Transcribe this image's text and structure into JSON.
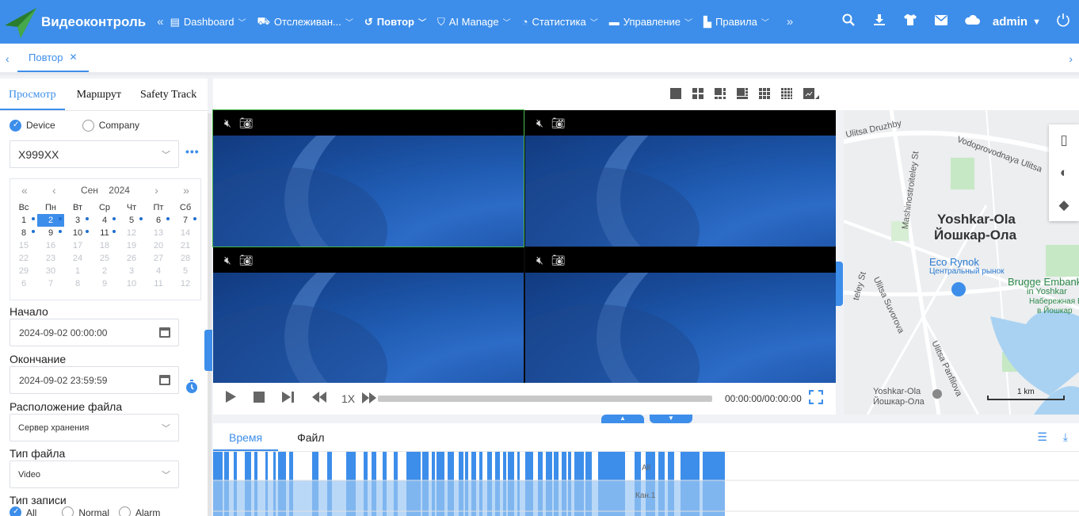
{
  "header": {
    "brand": "Видеоконтроль",
    "nav": [
      {
        "label": "Dashboard",
        "icon": "dashboard-icon"
      },
      {
        "label": "Отслеживан...",
        "icon": "car-icon"
      },
      {
        "label": "Повтор",
        "icon": "replay-icon",
        "active": true
      },
      {
        "label": "AI Manage",
        "icon": "shield-icon"
      },
      {
        "label": "Статистика",
        "icon": "pie-chart-icon"
      },
      {
        "label": "Управление",
        "icon": "bus-icon"
      },
      {
        "label": "Правила",
        "icon": "rule-icon"
      }
    ],
    "user": "admin"
  },
  "tabs": {
    "active": "Повтор"
  },
  "left": {
    "tabs": [
      "Просмотр",
      "Маршрут",
      "Safety Track"
    ],
    "source": {
      "device": "Device",
      "company": "Company"
    },
    "device_value": "X999XX",
    "calendar": {
      "month": "Сен",
      "year": "2024",
      "weekdays": [
        "Вс",
        "Пн",
        "Вт",
        "Ср",
        "Чт",
        "Пт",
        "Сб"
      ],
      "days": [
        "1",
        "2",
        "3",
        "4",
        "5",
        "6",
        "7",
        "8",
        "9",
        "10",
        "11",
        "12",
        "13",
        "14",
        "15",
        "16",
        "17",
        "18",
        "19",
        "20",
        "21",
        "22",
        "23",
        "24",
        "25",
        "26",
        "27",
        "28",
        "29",
        "30",
        "1",
        "2",
        "3",
        "4",
        "5",
        "6",
        "7",
        "8",
        "9",
        "10",
        "11",
        "12"
      ],
      "selected": "2",
      "with_records": [
        "1",
        "2",
        "3",
        "4",
        "5",
        "6",
        "7",
        "8",
        "9",
        "10",
        "11"
      ]
    },
    "start_label": "Начало",
    "start_value": "2024-09-02 00:00:00",
    "end_label": "Окончание",
    "end_value": "2024-09-02 23:59:59",
    "location_label": "Расположение файла",
    "location_value": "Сервер хранения",
    "filetype_label": "Тип файла",
    "filetype_value": "Video",
    "record_label": "Тип записи",
    "record_options": [
      "All",
      "Normal",
      "Alarm"
    ]
  },
  "player": {
    "speed": "1X",
    "time": "00:00:00/00:00:00"
  },
  "map": {
    "labels": {
      "street1": "Ulitsa Druzhby",
      "street2": "Vodoprovodnaya Ulitsa",
      "street3": "Mashinostroiteley St",
      "city_en": "Yoshkar-Ola",
      "city_ru": "Йошкар-Ола",
      "market_en": "Eco Rynok",
      "market_ru": "Центральный рынок",
      "emb_en": "Brugge Embankm",
      "emb_en2": "in Yoshkar",
      "emb_ru": "Набережная Бр",
      "emb_ru2": "в Йошкар",
      "street4": "Ulitsa Suvorova",
      "street5": "Ulitsa Panfilova",
      "street6": "teley St",
      "st_en": "Yoshkar-Ola",
      "st_ru": "Йошкар-Ола",
      "scale": "1 km"
    }
  },
  "bottom": {
    "tabs": [
      "Время",
      "Файл"
    ],
    "row1": "All",
    "row2": "Кан.1"
  }
}
